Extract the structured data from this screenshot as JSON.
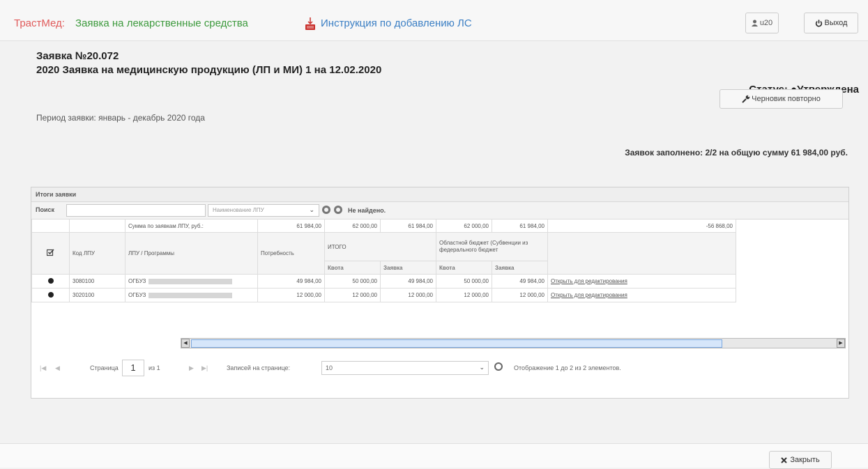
{
  "header": {
    "brand": "ТрастМед:",
    "app_title": "Заявка на лекарственные средства",
    "instruction_link": "Инструкция по добавлению ЛС",
    "user_label": "u20",
    "exit_label": "Выход"
  },
  "request": {
    "number": "Заявка №20.072",
    "title": "2020 Заявка на медицинскую продукцию (ЛП и МИ) 1 на 12.02.2020",
    "status_label": "Статус:",
    "status_value": "Утверждена",
    "draft_button": "Черновик повторно",
    "period": "Период заявки: январь - декабрь 2020 года",
    "summary": "Заявок заполнено: 2/2 на общую сумму 61 984,00 руб."
  },
  "grid": {
    "caption": "Итоги заявки",
    "search_label": "Поиск",
    "search_value": "",
    "lpu_placeholder": "Наименование ЛПУ",
    "not_found": "Не найдено.",
    "sum_label": "Сумма по заявкам ЛПУ, руб.:",
    "sums": [
      "61 984,00",
      "62 000,00",
      "61 984,00",
      "62 000,00",
      "61 984,00",
      "-56 868,00"
    ],
    "headers": {
      "code": "Код ЛПУ",
      "lpu": "ЛПУ / Программы",
      "need": "Потребность",
      "total": "ИТОГО",
      "regional": "Областной бюджет (Субвенции из федерального бюджет",
      "quota": "Квота",
      "order": "Заявка"
    },
    "rows": [
      {
        "code": "3080100",
        "org": "ОГБУЗ",
        "need": "49 984,00",
        "total_quota": "50 000,00",
        "total_order": "49 984,00",
        "reg_quota": "50 000,00",
        "reg_order": "49 984,00",
        "action": "Открыть для редактирования"
      },
      {
        "code": "3020100",
        "org": "ОГБУЗ",
        "need": "12 000,00",
        "total_quota": "12 000,00",
        "total_order": "12 000,00",
        "reg_quota": "12 000,00",
        "reg_order": "12 000,00",
        "action": "Открыть для редактирования"
      }
    ]
  },
  "pager": {
    "page_label": "Страница",
    "page_value": "1",
    "of_label": "из 1",
    "rpp_label": "Записей на странице:",
    "rpp_value": "10",
    "display_info": "Отображение 1 до 2 из 2 элементов."
  },
  "footer": {
    "close_label": "Закрыть"
  },
  "colors": {
    "brand": "#e05a5a",
    "app_title": "#3d9a3d",
    "link": "#3b7fc4"
  }
}
